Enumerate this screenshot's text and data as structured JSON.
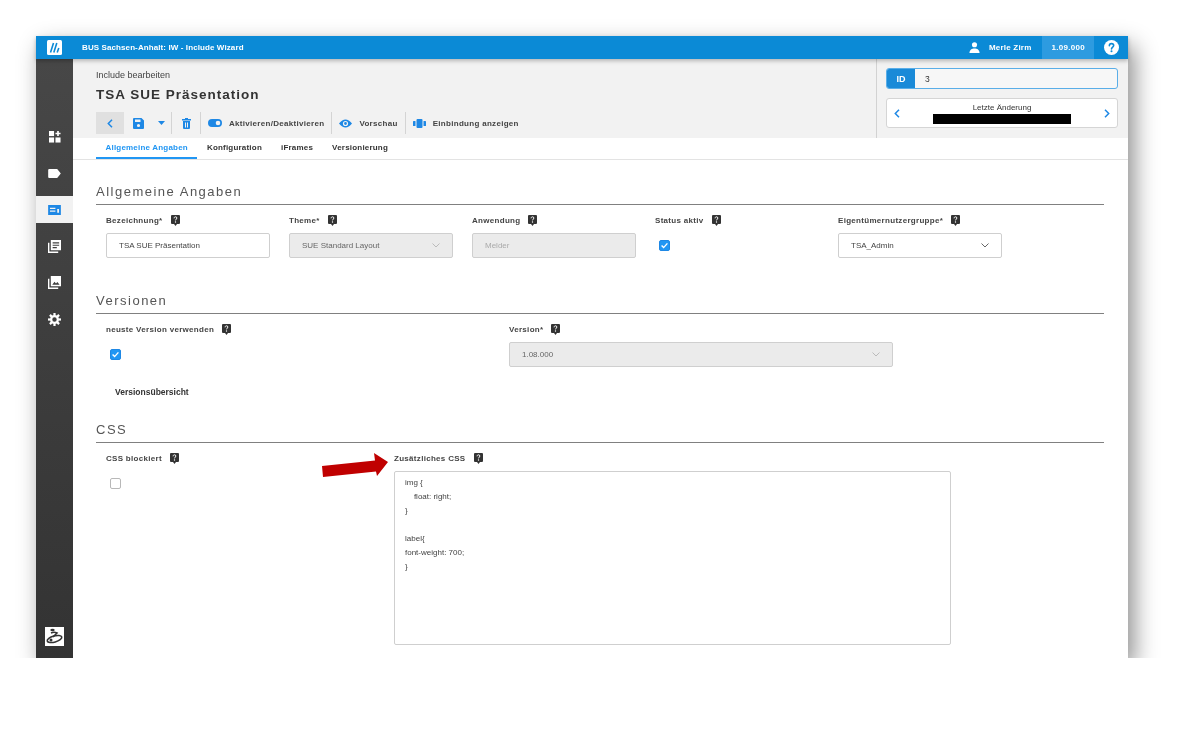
{
  "app_bar": {
    "title": "BUS Sachsen-Anhalt: IW - Include Wizard",
    "user": "Merle Zirm",
    "version": "1.09.000"
  },
  "sidebar": {
    "items": [
      {
        "kind": "dashboard",
        "selected": false
      },
      {
        "kind": "tag",
        "selected": false
      },
      {
        "kind": "card",
        "selected": true
      },
      {
        "kind": "documents",
        "selected": false
      },
      {
        "kind": "photos",
        "selected": false
      },
      {
        "kind": "settings",
        "selected": false
      }
    ]
  },
  "header": {
    "subtitle": "Include bearbeiten",
    "title": "TSA SUE Präsentation",
    "toolbar": [
      {
        "buttons": [
          {
            "kind": "back"
          },
          {
            "kind": "save"
          },
          {
            "kind": "menu"
          }
        ]
      },
      {
        "buttons": [
          {
            "kind": "delete"
          }
        ]
      },
      {
        "buttons": [
          {
            "kind": "toggle",
            "label": "Aktivieren/Deaktivieren"
          }
        ]
      },
      {
        "buttons": [
          {
            "kind": "preview",
            "label": "Vorschau"
          }
        ]
      },
      {
        "buttons": [
          {
            "kind": "embed",
            "label": "Einbindung anzeigen"
          }
        ]
      }
    ],
    "id_field": {
      "label": "ID",
      "value": "3"
    },
    "last_change": {
      "label": "Letzte Änderung",
      "redacted": true
    }
  },
  "tabs": [
    {
      "label": "Allgemeine Angaben",
      "selected": true
    },
    {
      "label": "Konfiguration",
      "selected": false
    },
    {
      "label": "iFrames",
      "selected": false
    },
    {
      "label": "Versionierung",
      "selected": false
    }
  ],
  "general": {
    "title": "Allgemeine Angaben",
    "fields": [
      {
        "kind": "text",
        "label": "Bezeichnung*",
        "value": "TSA SUE Präsentation",
        "disabled": false
      },
      {
        "kind": "select",
        "label": "Theme*",
        "value": "SUE Standard Layout",
        "disabled": true
      },
      {
        "kind": "text",
        "label": "Anwendung",
        "placeholder": "Melder",
        "disabled": true
      },
      {
        "kind": "checkbox",
        "label": "Status aktiv",
        "checked": true,
        "disabled": false
      },
      {
        "kind": "select",
        "label": "Eigentümernutzergruppe*",
        "value": "TSA_Admin",
        "disabled": false
      }
    ]
  },
  "versions": {
    "title": "Versionen",
    "fields": [
      {
        "kind": "checkbox",
        "label": "neuste Version verwenden",
        "checked": true,
        "disabled": false
      },
      {
        "kind": "select",
        "label": "Version*",
        "value": "1.08.000",
        "disabled": true
      }
    ],
    "link": "Versionsübersicht"
  },
  "css": {
    "title": "CSS",
    "fields": [
      {
        "kind": "checkbox",
        "label": "CSS blockiert",
        "checked": false,
        "disabled": false
      },
      {
        "kind": "textarea",
        "label": "Zusätzliches CSS",
        "value": "img {\n    float: right;\n}\n\nlabel{\nfont-weight: 700;\n}",
        "disabled": false
      }
    ]
  }
}
